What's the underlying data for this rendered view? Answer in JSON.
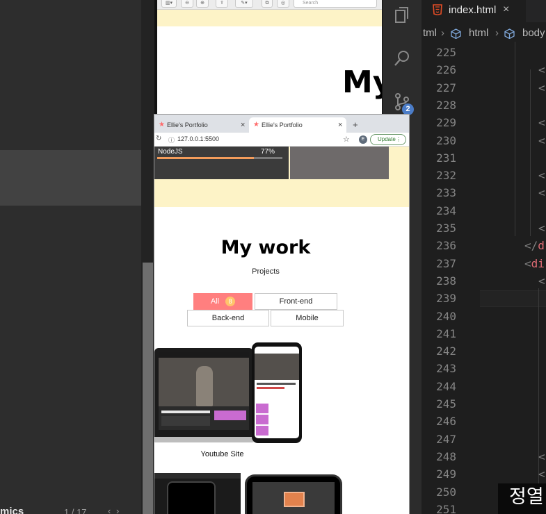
{
  "left_panel": {
    "bottom_label": "mics",
    "page_indicator": "1 / 17",
    "page_arrows": "‹ ›"
  },
  "browser_back": {
    "search_placeholder": "Search",
    "heading": "My"
  },
  "editor": {
    "tab_label": "index.html",
    "tab_close": "×",
    "breadcrumb": [
      "tml",
      "html",
      "body"
    ],
    "scm_badge": "2",
    "line_numbers": [
      "225",
      "226",
      "227",
      "228",
      "229",
      "230",
      "231",
      "232",
      "233",
      "234",
      "235",
      "236",
      "237",
      "238",
      "239",
      "240",
      "241",
      "242",
      "243",
      "244",
      "245",
      "246",
      "247",
      "248",
      "249",
      "250",
      "251"
    ],
    "code_lines": [
      {
        "line": "226",
        "text": "<"
      },
      {
        "line": "227",
        "text": "<"
      },
      {
        "line": "229",
        "text": "<"
      },
      {
        "line": "230",
        "text": "<"
      },
      {
        "line": "232",
        "text": "<"
      },
      {
        "line": "233",
        "text": "<"
      },
      {
        "line": "235",
        "text": "<"
      },
      {
        "line": "236",
        "bracket": "</",
        "tag": "d"
      },
      {
        "line": "237",
        "bracket": "<",
        "tag": "di"
      },
      {
        "line": "238",
        "text": "<"
      },
      {
        "line": "248",
        "text": "<"
      },
      {
        "line": "249",
        "text": "<"
      }
    ]
  },
  "browser_front": {
    "tabs": [
      {
        "label": "Ellie's Portfolio",
        "close": "×"
      },
      {
        "label": "Ellie's Portfolio",
        "close": "×"
      }
    ],
    "new_tab": "+",
    "url": "127.0.0.1:5500",
    "profile_initial": "E",
    "update_label": "Update",
    "skill": {
      "name": "NodeJS",
      "percent_text": "77%",
      "percent": 77
    },
    "work_title": "My work",
    "work_subtitle": "Projects",
    "categories": [
      {
        "label": "All",
        "count": "8",
        "active": true
      },
      {
        "label": "Front-end"
      },
      {
        "label": "Back-end"
      },
      {
        "label": "Mobile"
      }
    ],
    "project_1_title": "Youtube Site"
  },
  "subtitle": "정열"
}
